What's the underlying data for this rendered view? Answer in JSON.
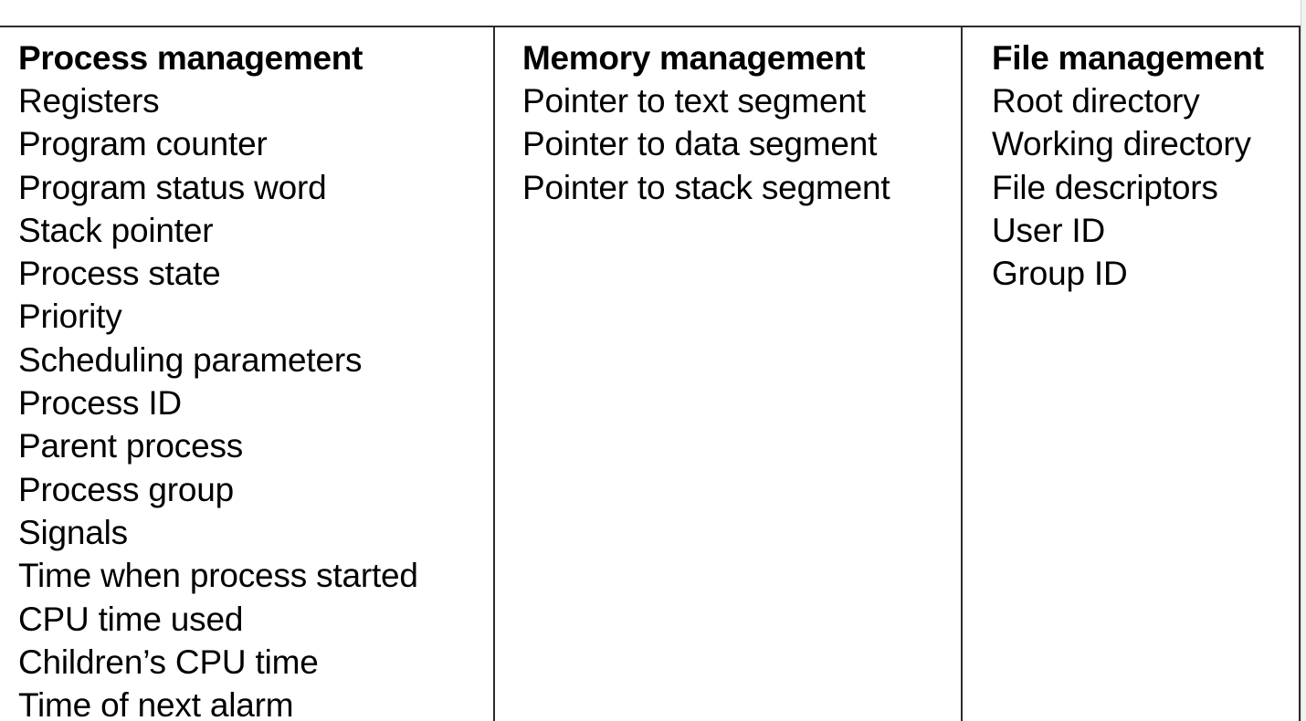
{
  "table": {
    "columns": [
      {
        "header": "Process management",
        "items": [
          "Registers",
          "Program counter",
          "Program status word",
          "Stack pointer",
          "Process state",
          "Priority",
          "Scheduling parameters",
          "Process ID",
          "Parent process",
          "Process group",
          "Signals",
          "Time when process started",
          "CPU time used",
          "Children’s CPU time",
          "Time of next alarm"
        ]
      },
      {
        "header": "Memory management",
        "items": [
          "Pointer to text segment",
          "Pointer to data segment",
          "Pointer to stack segment"
        ]
      },
      {
        "header": "File management",
        "items": [
          "Root directory",
          "Working directory",
          "File descriptors",
          "User ID",
          "Group ID"
        ]
      }
    ]
  }
}
